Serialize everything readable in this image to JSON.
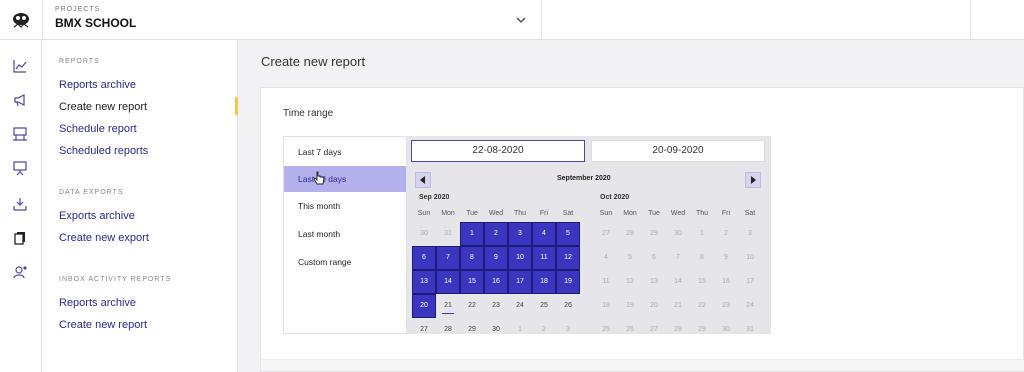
{
  "project": {
    "label": "PROJECTS",
    "name": "BMX SCHOOL"
  },
  "nav": {
    "reports_head": "REPORTS",
    "reports_archive": "Reports archive",
    "create_report": "Create new report",
    "schedule_report": "Schedule report",
    "scheduled_reports": "Scheduled reports",
    "exports_head": "DATA EXPORTS",
    "exports_archive": "Exports archive",
    "create_export": "Create new export",
    "inbox_head": "INBOX ACTIVITY REPORTS",
    "inbox_reports_archive": "Reports archive",
    "inbox_create_report": "Create new report"
  },
  "page": {
    "title": "Create new report",
    "section_title": "Time range"
  },
  "ranges": [
    "Last 7 days",
    "Last 30 days",
    "This month",
    "Last month",
    "Custom range"
  ],
  "selected_range": "Last 30 days",
  "date_from": "22-08-2020",
  "date_to": "20-09-2020",
  "calendar": {
    "header": "September 2020",
    "weekdays": [
      "Sun",
      "Mon",
      "Tue",
      "Wed",
      "Thu",
      "Fri",
      "Sat"
    ],
    "months": [
      {
        "title": "Sep 2020",
        "weeks": [
          [
            "30",
            "31",
            "1",
            "2",
            "3",
            "4",
            "5"
          ],
          [
            "6",
            "7",
            "8",
            "9",
            "10",
            "11",
            "12"
          ],
          [
            "13",
            "14",
            "15",
            "16",
            "17",
            "18",
            "19"
          ],
          [
            "20",
            "21",
            "22",
            "23",
            "24",
            "25",
            "26"
          ],
          [
            "27",
            "28",
            "29",
            "30",
            "1",
            "2",
            "3"
          ]
        ]
      },
      {
        "title": "Oct 2020",
        "weeks": [
          [
            "27",
            "28",
            "29",
            "30",
            "1",
            "2",
            "3"
          ],
          [
            "4",
            "5",
            "6",
            "7",
            "8",
            "9",
            "10"
          ],
          [
            "11",
            "12",
            "13",
            "14",
            "15",
            "16",
            "17"
          ],
          [
            "18",
            "19",
            "20",
            "21",
            "22",
            "23",
            "24"
          ],
          [
            "25",
            "26",
            "27",
            "28",
            "29",
            "30",
            "31"
          ]
        ]
      }
    ]
  },
  "colors": {
    "accent": "#3a36c0",
    "selected_bg": "#b3b0ec",
    "nav_link": "#2a2a8c",
    "marker": "#f2c94c"
  },
  "icons": [
    "logo-icon",
    "chevron-down-icon",
    "chart-line-icon",
    "megaphone-icon",
    "billboard-icon",
    "presentation-icon",
    "download-tray-icon",
    "copy-pages-icon",
    "users-gear-icon",
    "pointer-hand-icon",
    "arrow-left-icon",
    "arrow-right-icon"
  ]
}
